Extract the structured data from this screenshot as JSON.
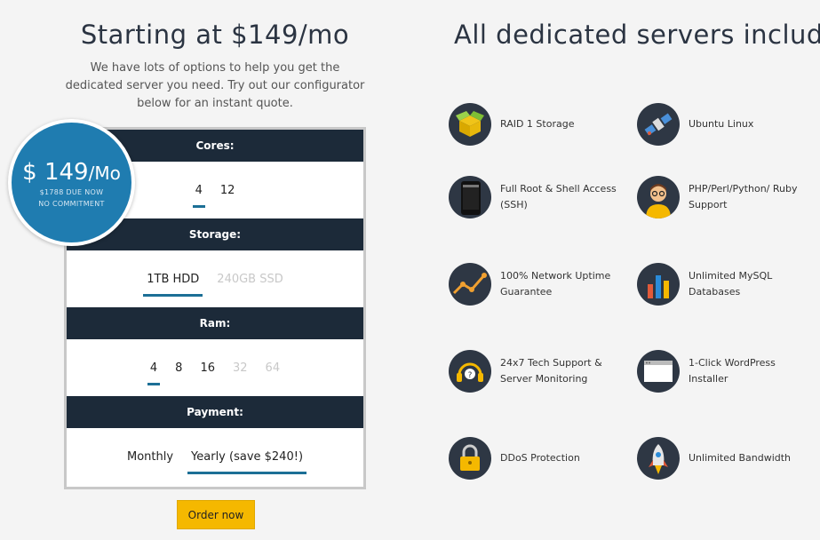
{
  "left": {
    "title": "Starting at $149/mo",
    "subtitle": "We have lots of options to help you get the dedicated server you need. Try out our configurator below for an instant quote."
  },
  "right": {
    "title": "All dedicated servers include:"
  },
  "price": {
    "amount": "$ 149",
    "per": "/Mo",
    "due": "$1788 DUE NOW",
    "commit": "NO COMMITMENT"
  },
  "config": {
    "cores": {
      "label": "Cores:",
      "options": [
        "4",
        "12"
      ]
    },
    "storage": {
      "label": "Storage:",
      "options": [
        "1TB HDD",
        "240GB SSD"
      ]
    },
    "ram": {
      "label": "Ram:",
      "options": [
        "4",
        "8",
        "16",
        "32",
        "64"
      ]
    },
    "payment": {
      "label": "Payment:",
      "options": [
        "Monthly",
        "Yearly (save $240!)"
      ]
    }
  },
  "order_label": "Order now",
  "features": [
    {
      "icon": "box-icon",
      "text": "RAID 1 Storage"
    },
    {
      "icon": "satellite-icon",
      "text": "Ubuntu Linux"
    },
    {
      "icon": "phone-icon",
      "text": "Full Root & Shell Access (SSH)"
    },
    {
      "icon": "developer-icon",
      "text": "PHP/Perl/Python/ Ruby Support"
    },
    {
      "icon": "uptime-chart-icon",
      "text": "100% Network Uptime Guarantee"
    },
    {
      "icon": "bar-chart-icon",
      "text": "Unlimited MySQL Databases"
    },
    {
      "icon": "headset-icon",
      "text": "24x7 Tech Support & Server Monitoring"
    },
    {
      "icon": "browser-window-icon",
      "text": "1-Click WordPress Installer"
    },
    {
      "icon": "padlock-icon",
      "text": "DDoS Protection"
    },
    {
      "icon": "rocket-icon",
      "text": "Unlimited Bandwidth"
    }
  ],
  "colors": {
    "navy": "#1c2a39",
    "blue": "#1f7cb0",
    "accent": "#1c6f96",
    "button": "#f5b800",
    "icon_bg": "#2e3744"
  }
}
